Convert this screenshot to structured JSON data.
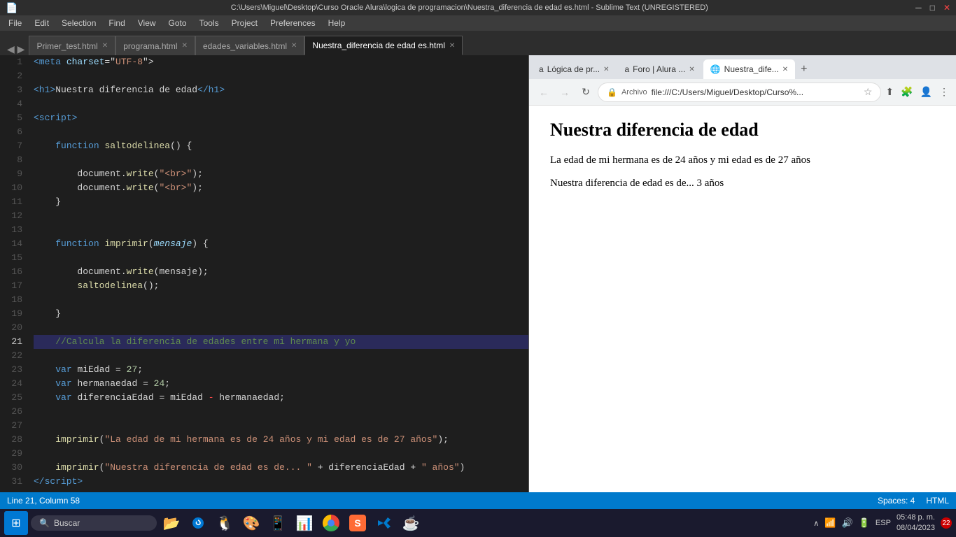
{
  "titlebar": {
    "text": "C:\\Users\\Miguel\\Desktop\\Curso Oracle Alura\\logica de programacion\\Nuestra_diferencia de edad es.html - Sublime Text (UNREGISTERED)",
    "minimize": "─",
    "maximize": "□",
    "close": "✕"
  },
  "menubar": {
    "items": [
      "File",
      "Edit",
      "Selection",
      "Find",
      "View",
      "Goto",
      "Tools",
      "Project",
      "Preferences",
      "Help"
    ]
  },
  "tabs": [
    {
      "label": "Primer_test.html",
      "active": false
    },
    {
      "label": "programa.html",
      "active": false
    },
    {
      "label": "edades_variables.html",
      "active": false
    },
    {
      "label": "Nuestra_diferencia de edad es.html",
      "active": true
    }
  ],
  "editor": {
    "current_line": 21,
    "current_col": 58
  },
  "browser": {
    "tabs": [
      {
        "favicon": "a",
        "label": "Lógica de pr...",
        "active": false
      },
      {
        "favicon": "a",
        "label": "Foro | Alura ...",
        "active": false
      },
      {
        "favicon": "🌐",
        "label": "Nuestra_dife...",
        "active": true
      }
    ],
    "address": "file:///C:/Users/Miguel/Desktop/Curso%...",
    "title": "Nuestra diferencia de edad",
    "line1": "La edad de mi hermana es de 24 años y mi edad es de 27 años",
    "line2": "Nuestra diferencia de edad es de... 3 años"
  },
  "statusbar": {
    "position": "Line 21, Column 58",
    "spaces": "Spaces: 4",
    "encoding": "HTML"
  },
  "taskbar": {
    "search_placeholder": "Buscar",
    "time": "05:48 p. m.",
    "date": "08/04/2023",
    "language": "ESP",
    "notification": "22"
  }
}
